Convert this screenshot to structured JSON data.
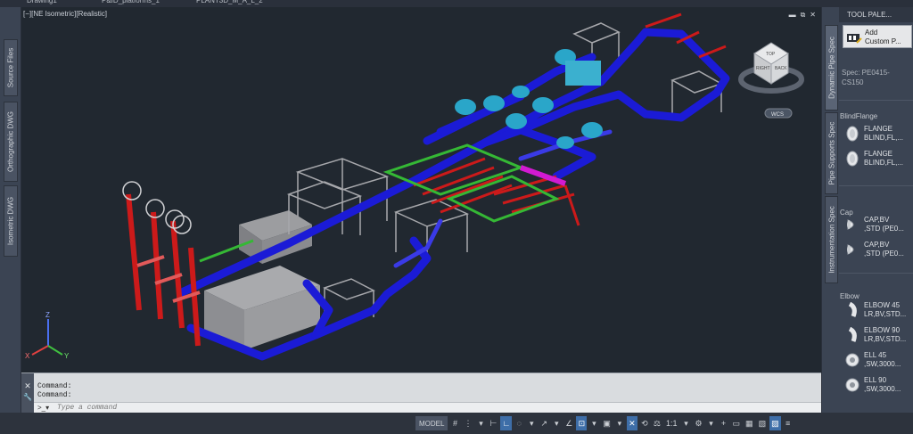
{
  "file_tabs": [
    "Drawing1*",
    "P&ID_platforms_1*",
    "PLANT3D_M_A_L_2*"
  ],
  "left_tabs": [
    "Source Files",
    "Orthographic DWG",
    "Isometric DWG"
  ],
  "viewport": {
    "label": "[−][NE Isometric][Realistic]",
    "controls": [
      "▬",
      "⧉",
      "✕"
    ],
    "viewcube_faces": [
      "TOP",
      "RIGHT",
      "BACK"
    ],
    "wcs_label": "WCS",
    "axes": {
      "x": "X",
      "y": "Y",
      "z": "Z"
    }
  },
  "command_line": {
    "history": [
      "Command:",
      "Command:"
    ],
    "close_icon": "✕",
    "settings_icon": "🔧",
    "prompt_glyph": ">_▾",
    "placeholder": "Type a command"
  },
  "status_bar": {
    "items": [
      {
        "label": "MODEL",
        "kind": "model"
      },
      {
        "label": "#",
        "icon": "grid-icon"
      },
      {
        "label": "⋮",
        "icon": "snap-icon"
      },
      {
        "label": "▾",
        "icon": "snap-menu-icon"
      },
      {
        "label": "⊢",
        "icon": "infer-icon"
      },
      {
        "label": "∟",
        "icon": "ortho-icon",
        "active": true
      },
      {
        "label": "◌",
        "icon": "polar-icon"
      },
      {
        "label": "▾",
        "icon": "polar-menu-icon"
      },
      {
        "label": "↗",
        "icon": "isodraft-icon"
      },
      {
        "label": "▾",
        "icon": "isodraft-menu-icon"
      },
      {
        "label": "∠",
        "icon": "osnap-track-icon"
      },
      {
        "label": "⊡",
        "icon": "osnap-icon",
        "active": true
      },
      {
        "label": "▾",
        "icon": "osnap-menu-icon"
      },
      {
        "label": "▣",
        "icon": "3dosnap-icon"
      },
      {
        "label": "▾",
        "icon": "3dosnap-menu-icon"
      },
      {
        "label": "✕",
        "icon": "annotation-visibility-icon",
        "active": true
      },
      {
        "label": "⟲",
        "icon": "autoscale-icon"
      },
      {
        "label": "⚖",
        "icon": "annotation-scale-icon"
      },
      {
        "label": "1:1",
        "icon": "scale-icon"
      },
      {
        "label": "▾",
        "icon": "scale-menu-icon"
      },
      {
        "label": "⚙",
        "icon": "workspace-icon"
      },
      {
        "label": "▾",
        "icon": "workspace-menu-icon"
      },
      {
        "label": "+",
        "icon": "annotation-monitor-icon"
      },
      {
        "label": "▭",
        "icon": "units-icon"
      },
      {
        "label": "▦",
        "icon": "isolate-icon"
      },
      {
        "label": "▧",
        "icon": "hardware-accel-icon"
      },
      {
        "label": "▨",
        "icon": "clean-screen-icon",
        "active": true
      },
      {
        "label": "≡",
        "icon": "customization-icon"
      }
    ]
  },
  "palette": {
    "title": "TOOL PALE...",
    "tabs": [
      "Dynamic Pipe Spec",
      "Pipe Supports Spec",
      "Instrumentation Spec"
    ],
    "add_button": {
      "line1": "Add",
      "line2": "Custom P..."
    },
    "spec_line1": "Spec: PE0415-",
    "spec_line2": "CS150",
    "sections": [
      {
        "title": "BlindFlange",
        "items": [
          {
            "line1": "FLANGE",
            "line2": "BLIND,FL,...",
            "icon": "blind-flange-icon"
          },
          {
            "line1": "FLANGE",
            "line2": "BLIND,FL,...",
            "icon": "blind-flange-icon"
          }
        ]
      },
      {
        "title": "Cap",
        "items": [
          {
            "line1": "CAP,BV",
            "line2": ",STD (PE0...",
            "icon": "cap-icon"
          },
          {
            "line1": "CAP,BV",
            "line2": ",STD (PE0...",
            "icon": "cap-icon"
          }
        ]
      },
      {
        "title": "Elbow",
        "items": [
          {
            "line1": "ELBOW 45",
            "line2": "LR,BV,STD...",
            "icon": "elbow-icon"
          },
          {
            "line1": "ELBOW 90",
            "line2": "LR,BV,STD...",
            "icon": "elbow-icon"
          },
          {
            "line1": "ELL 45",
            "line2": ",SW,3000...",
            "icon": "ell-icon"
          },
          {
            "line1": "ELL 90",
            "line2": ",SW,3000...",
            "icon": "ell-icon"
          }
        ]
      }
    ]
  },
  "colors": {
    "viewport_bg": "#212830",
    "pipe_blue": "#1b1bd6",
    "pipe_red": "#cc1a1a",
    "pipe_green": "#35b835",
    "pipe_magenta": "#d21ad2",
    "equipment_cyan": "#2aa6c9",
    "structure_gray": "#8e9096"
  }
}
